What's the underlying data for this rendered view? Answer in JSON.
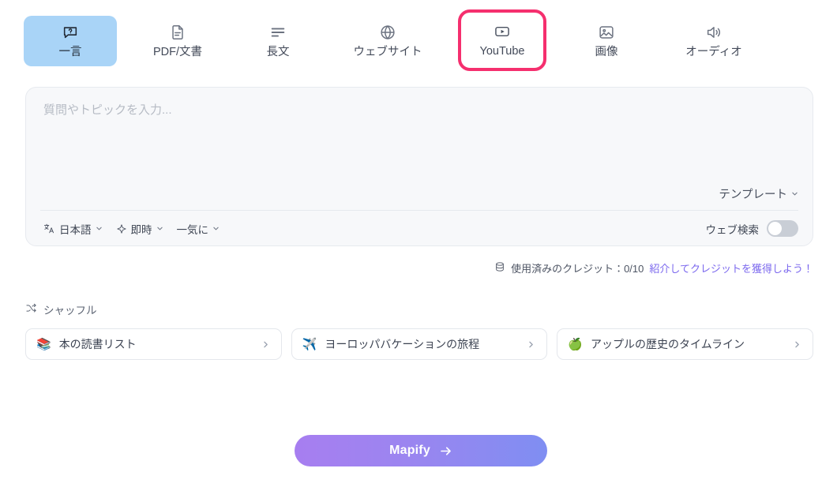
{
  "theme": {
    "accent_pink": "#f52f6e",
    "active_tab_bg": "#a9d4f7",
    "link_purple": "#7b68ee",
    "button_gradient_from": "#a77ef0",
    "button_gradient_to": "#7f8ef2",
    "page_bg": "#ffffff",
    "composer_bg": "#f7f8fa"
  },
  "tabs": [
    {
      "label": "一言",
      "icon": "question-bubble-icon",
      "state": "active"
    },
    {
      "label": "PDF/文書",
      "icon": "document-icon",
      "state": "default"
    },
    {
      "label": "長文",
      "icon": "text-lines-icon",
      "state": "default"
    },
    {
      "label": "ウェブサイト",
      "icon": "globe-icon",
      "state": "default"
    },
    {
      "label": "YouTube",
      "icon": "video-play-icon",
      "state": "highlighted"
    },
    {
      "label": "画像",
      "icon": "image-icon",
      "state": "default"
    },
    {
      "label": "オーディオ",
      "icon": "speaker-icon",
      "state": "default"
    }
  ],
  "composer": {
    "placeholder": "質問やトピックを入力...",
    "value": "",
    "template_label": "テンプレート",
    "template_caret_icon": "chevron-down-icon",
    "language_chip": {
      "label": "日本語",
      "icon": "translate-icon",
      "caret": "chevron-down-icon"
    },
    "mode_chip": {
      "label": "即時",
      "icon": "sparkle-icon",
      "caret": "chevron-down-icon"
    },
    "speed_chip": {
      "label": "一気に",
      "icon": "none",
      "caret": "chevron-down-icon"
    },
    "web_search": {
      "label": "ウェブ検索",
      "enabled": false
    }
  },
  "credits": {
    "icon": "database-icon",
    "text": "使用済みのクレジット：0/10",
    "used": 0,
    "total": 10,
    "refer_link": "紹介してクレジットを獲得しよう！"
  },
  "shuffle": {
    "label": "シャッフル",
    "icon": "shuffle-icon"
  },
  "suggestion_cards": [
    {
      "emoji": "📚",
      "label": "本の読書リスト",
      "chevron": "chevron-right-icon"
    },
    {
      "emoji": "✈️",
      "label": "ヨーロッパバケーションの旅程",
      "chevron": "chevron-right-icon"
    },
    {
      "emoji": "🍏",
      "label": "アップルの歴史のタイムライン",
      "chevron": "chevron-right-icon"
    }
  ],
  "submit": {
    "label": "Mapify",
    "arrow_icon": "arrow-right-icon"
  }
}
